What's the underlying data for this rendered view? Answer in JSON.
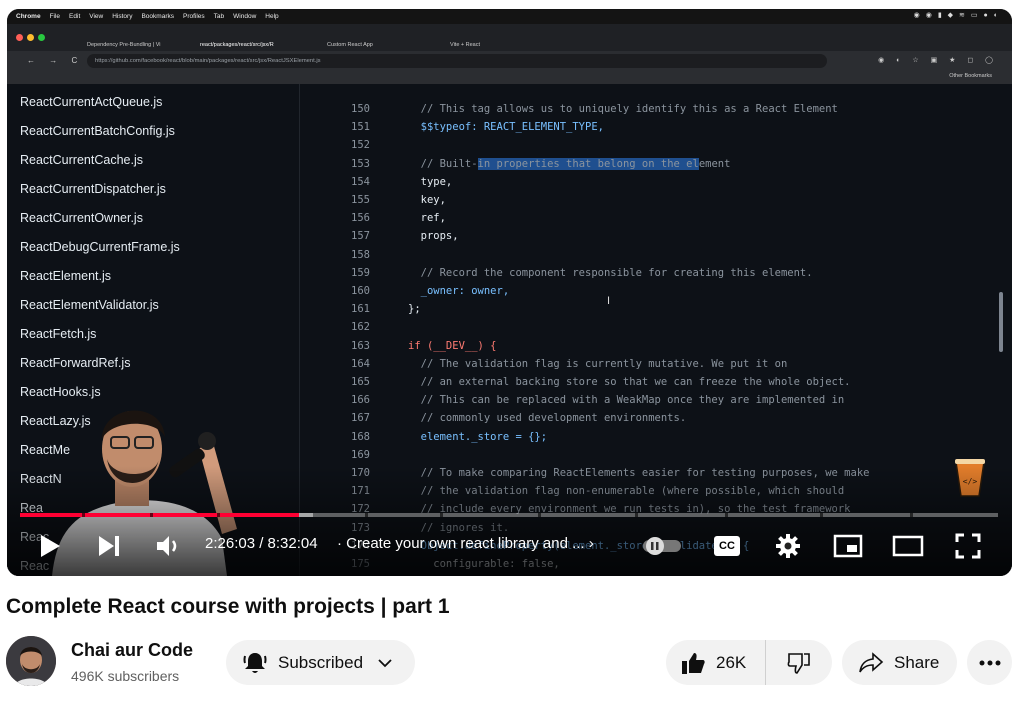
{
  "browser": {
    "menubar": [
      "Chrome",
      "File",
      "Edit",
      "View",
      "History",
      "Bookmarks",
      "Profiles",
      "Tab",
      "Window",
      "Help"
    ],
    "tabs": [
      "Dependency Pre-Bundling | Vi",
      "react/packages/react/src/jsx/R",
      "Custom React App",
      "Vite + React"
    ],
    "url": "https://github.com/facebook/react/blob/main/packages/react/src/jsx/ReactJSXElement.js",
    "bookmarks_label": "Other Bookmarks"
  },
  "files": [
    "ReactCurrentActQueue.js",
    "ReactCurrentBatchConfig.js",
    "ReactCurrentCache.js",
    "ReactCurrentDispatcher.js",
    "ReactCurrentOwner.js",
    "ReactDebugCurrentFrame.js",
    "ReactElement.js",
    "ReactElementValidator.js",
    "ReactFetch.js",
    "ReactForwardRef.js",
    "ReactHooks.js",
    "ReactLazy.js",
    "ReactMe",
    "ReactN",
    "Rea",
    "Reac",
    "Reac"
  ],
  "code": [
    {
      "n": "150",
      "t": "  // This tag allows us to uniquely identify this as a React Element"
    },
    {
      "n": "151",
      "t": "  $$typeof: REACT_ELEMENT_TYPE,"
    },
    {
      "n": "152",
      "t": ""
    },
    {
      "n": "153",
      "t": "  // Built-in properties that belong on the element"
    },
    {
      "n": "154",
      "t": "  type,"
    },
    {
      "n": "155",
      "t": "  key,"
    },
    {
      "n": "156",
      "t": "  ref,"
    },
    {
      "n": "157",
      "t": "  props,"
    },
    {
      "n": "158",
      "t": ""
    },
    {
      "n": "159",
      "t": "  // Record the component responsible for creating this element."
    },
    {
      "n": "160",
      "t": "  _owner: owner,"
    },
    {
      "n": "161",
      "t": "};"
    },
    {
      "n": "162",
      "t": ""
    },
    {
      "n": "163",
      "t": "if (__DEV__) {"
    },
    {
      "n": "164",
      "t": "  // The validation flag is currently mutative. We put it on"
    },
    {
      "n": "165",
      "t": "  // an external backing store so that we can freeze the whole object."
    },
    {
      "n": "166",
      "t": "  // This can be replaced with a WeakMap once they are implemented in"
    },
    {
      "n": "167",
      "t": "  // commonly used development environments."
    },
    {
      "n": "168",
      "t": "  element._store = {};"
    },
    {
      "n": "169",
      "t": ""
    },
    {
      "n": "170",
      "t": "  // To make comparing ReactElements easier for testing purposes, we make"
    },
    {
      "n": "171",
      "t": "  // the validation flag non-enumerable (where possible, which should"
    },
    {
      "n": "172",
      "t": "  // include every environment we run tests in), so the test framework"
    },
    {
      "n": "173",
      "t": "  // ignores it."
    },
    {
      "n": "174",
      "t": "  Object.defineProperty(element._store, 'validated', {"
    },
    {
      "n": "175",
      "t": "    configurable: false,"
    }
  ],
  "player": {
    "time": "2:26:03 / 8:32:04",
    "chapter": "· Create your own react library and ...",
    "progress_played": 0.285,
    "progress_buffered": 0.3,
    "icons": [
      "play-icon",
      "next-icon",
      "volume-icon",
      "autoplay-toggle",
      "captions-icon",
      "settings-icon",
      "miniplayer-icon",
      "theater-icon",
      "fullscreen-icon"
    ],
    "cc_label": "CC"
  },
  "video": {
    "title": "Complete React course with projects | part 1",
    "channel": "Chai aur Code",
    "subscribers": "496K subscribers",
    "subscribe_label": "Subscribed",
    "likes": "26K",
    "share_label": "Share"
  },
  "colors": {
    "accent": "#ff0033",
    "code_bg": "#0d1117",
    "highlight": "#1f4f8f"
  }
}
